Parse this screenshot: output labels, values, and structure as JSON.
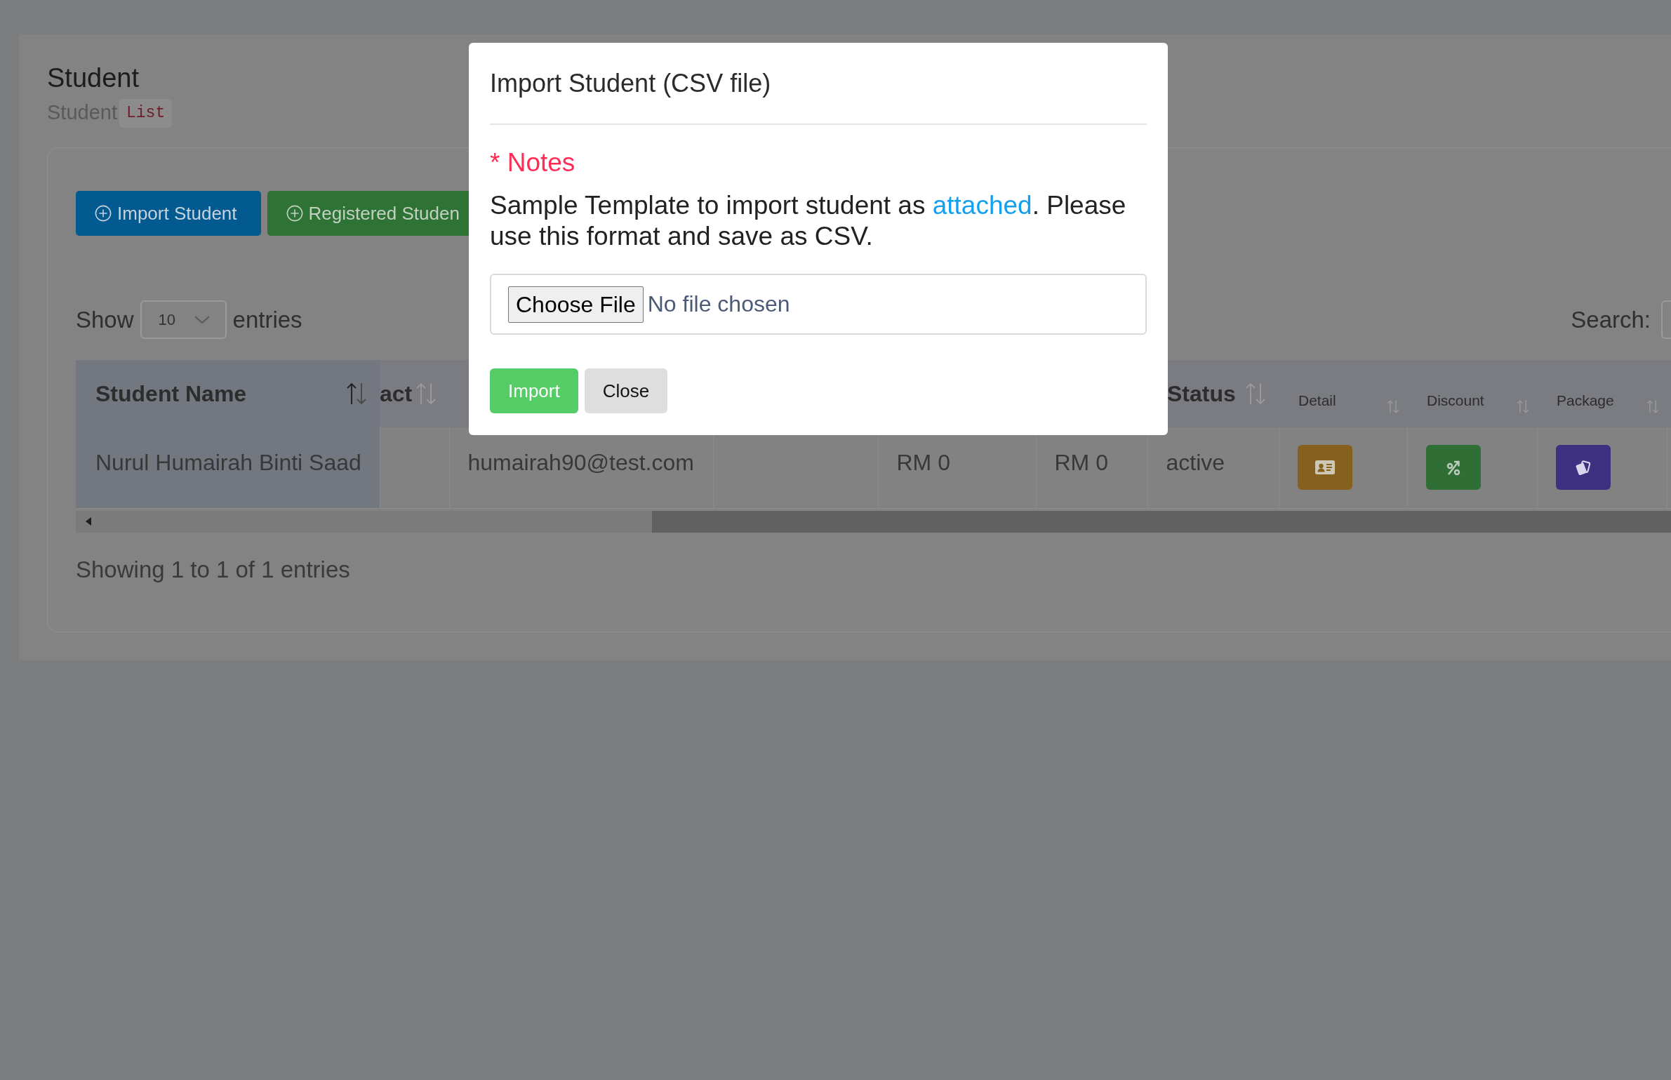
{
  "page": {
    "title": "Student",
    "subtitle": "Student",
    "subtitle_tag": "List"
  },
  "toolbar": {
    "buttons": [
      {
        "label": "Import Student",
        "kind": "primary"
      },
      {
        "label": "Registered Studen",
        "kind": "success"
      }
    ]
  },
  "length_menu": {
    "label_before": "Show",
    "value": "10",
    "label_after": "entries"
  },
  "search": {
    "label": "Search:"
  },
  "table": {
    "columns": [
      {
        "label": "Student Name",
        "kind": "text",
        "pinned": true,
        "sorted": true
      },
      {
        "label": "act",
        "kind": "text",
        "pinned": false,
        "sorted": false
      },
      {
        "pinned": false
      },
      {
        "pinned": false
      },
      {
        "pinned": false
      },
      {
        "pinned": false
      },
      {
        "label": "Status",
        "kind": "text",
        "pinned": false,
        "sorted": false
      },
      {
        "label": "Detail",
        "kind": "action",
        "pinned": false,
        "sorted": false
      },
      {
        "label": "Discount",
        "kind": "action",
        "pinned": false,
        "sorted": false
      },
      {
        "label": "Package",
        "kind": "action",
        "pinned": false,
        "sorted": false
      }
    ],
    "rows": [
      {
        "cells": [
          {
            "kind": "text",
            "text": "Nurul Humairah Binti Saad"
          },
          {
            "kind": "empty"
          },
          {
            "kind": "text",
            "text": "humairah90@test.com"
          },
          {
            "kind": "empty"
          },
          {
            "kind": "text",
            "text": "RM 0"
          },
          {
            "kind": "text",
            "text": "RM 0"
          },
          {
            "kind": "text",
            "text": "active"
          },
          {
            "kind": "detail",
            "color": "#86611d"
          },
          {
            "kind": "discount",
            "color": "#2f6e34"
          },
          {
            "kind": "package",
            "color": "#3e3080"
          }
        ]
      }
    ]
  },
  "info": "Showing 1 to 1 of 1 entries",
  "modal": {
    "title": "Import Student (CSV file)",
    "notes_heading": "* Notes",
    "message": [
      {
        "kind": "text",
        "text": "Sample Template to import student as "
      },
      {
        "kind": "link",
        "text": "attached"
      },
      {
        "kind": "text",
        "text": ". Please use this format and save as CSV."
      }
    ],
    "file_input": {
      "button": "Choose File",
      "status": "No file chosen"
    },
    "buttons": [
      {
        "label": "Import",
        "kind": "primary"
      },
      {
        "label": "Close",
        "kind": "secondary"
      }
    ]
  }
}
